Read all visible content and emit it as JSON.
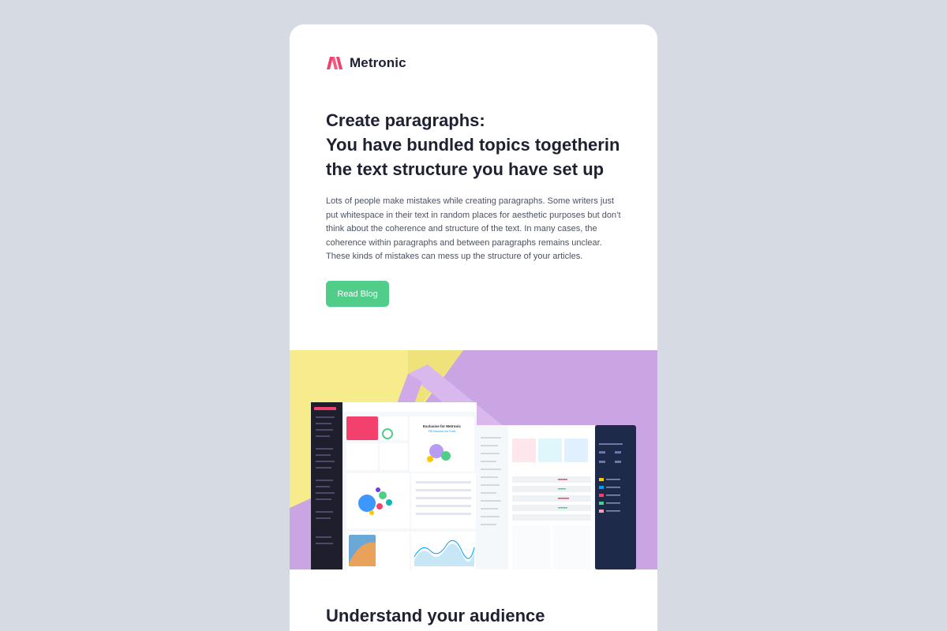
{
  "brand": {
    "name": "Metronic",
    "accent": "#f1416c"
  },
  "article": {
    "headline_lines": [
      "Create paragraphs:",
      "You have bundled topics togetherin",
      "the text structure you have set up"
    ],
    "body": "Lots of people make mistakes while creating paragraphs. Some writers just put whitespace in their text in random places for aesthetic purposes but don’t think about the coherence and structure of the text. In many cases, the coherence within paragraphs and between paragraphs remains unclear. These kinds of mistakes can mess up the structure of your articles.",
    "cta_label": "Read Blog",
    "cta_color": "#50cd89"
  },
  "hero": {
    "promo_title": "Exclusive for Metronic",
    "promo_subtitle": "Fill Vectors for Free"
  },
  "next_section": {
    "title": "Understand your audience"
  },
  "colors": {
    "page_bg": "#d6dae3",
    "card_bg": "#ffffff",
    "heading": "#1e2132",
    "text": "#4b5262",
    "hero_purple": "#c9a6e3",
    "hero_yellow": "#f6ec8c"
  }
}
